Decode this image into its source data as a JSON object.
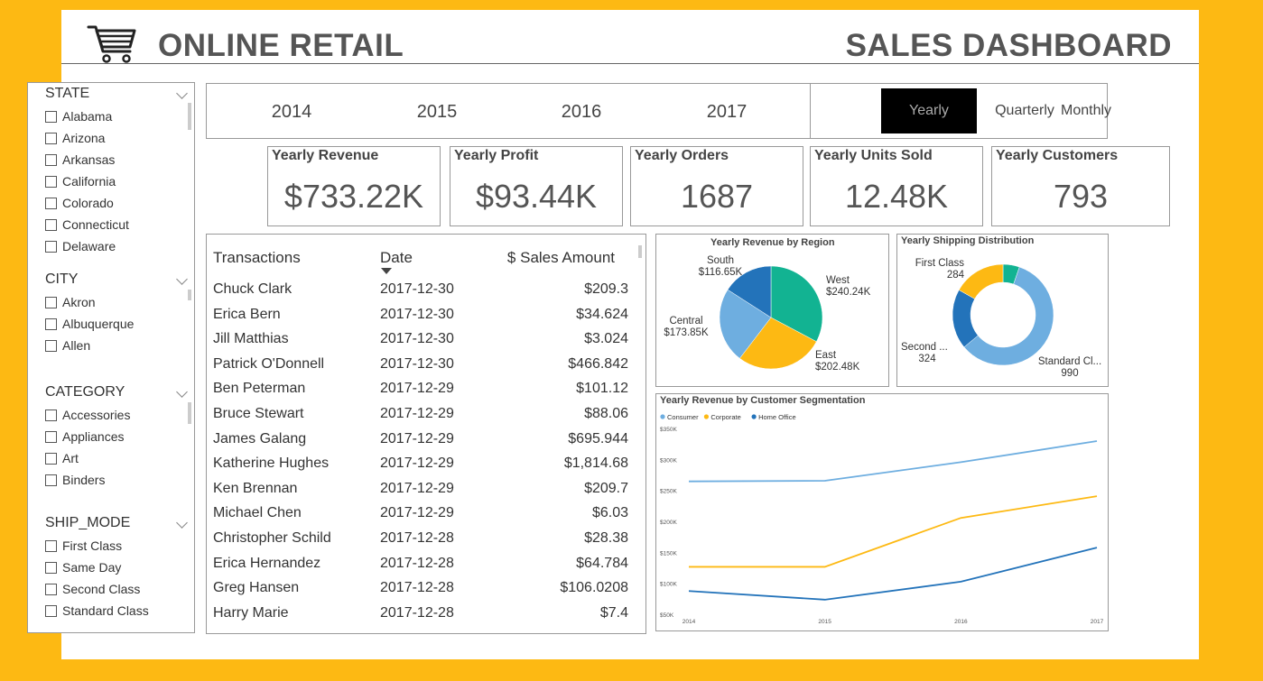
{
  "header": {
    "left_title": "ONLINE RETAIL",
    "right_title": "SALES DASHBOARD",
    "cart_icon": "shopping-cart-icon"
  },
  "filters": {
    "state": {
      "label": "STATE",
      "items": [
        "Alabama",
        "Arizona",
        "Arkansas",
        "California",
        "Colorado",
        "Connecticut",
        "Delaware"
      ]
    },
    "city": {
      "label": "CITY",
      "items": [
        "Akron",
        "Albuquerque",
        "Allen"
      ]
    },
    "category": {
      "label": "CATEGORY",
      "items": [
        "Accessories",
        "Appliances",
        "Art",
        "Binders"
      ]
    },
    "ship_mode": {
      "label": "SHIP_MODE",
      "items": [
        "First Class",
        "Same Day",
        "Second Class",
        "Standard Class"
      ]
    }
  },
  "years": [
    "2014",
    "2015",
    "2016",
    "2017"
  ],
  "periods": {
    "yearly": "Yearly",
    "quarterly": "Quarterly",
    "monthly": "Monthly",
    "active": "Yearly"
  },
  "kpis": [
    {
      "label": "Yearly Revenue",
      "value": "$733.22K"
    },
    {
      "label": "Yearly Profit",
      "value": "$93.44K"
    },
    {
      "label": "Yearly Orders",
      "value": "1687"
    },
    {
      "label": "Yearly Units Sold",
      "value": "12.48K"
    },
    {
      "label": "Yearly Customers",
      "value": "793"
    }
  ],
  "transactions": {
    "headers": {
      "name": "Transactions",
      "date": "Date",
      "amount": "$ Sales Amount"
    },
    "rows": [
      [
        "Chuck Clark",
        "2017-12-30",
        "$209.3"
      ],
      [
        "Erica Bern",
        "2017-12-30",
        "$34.624"
      ],
      [
        "Jill Matthias",
        "2017-12-30",
        "$3.024"
      ],
      [
        "Patrick O'Donnell",
        "2017-12-30",
        "$466.842"
      ],
      [
        "Ben Peterman",
        "2017-12-29",
        "$101.12"
      ],
      [
        "Bruce Stewart",
        "2017-12-29",
        "$88.06"
      ],
      [
        "James Galang",
        "2017-12-29",
        "$695.944"
      ],
      [
        "Katherine Hughes",
        "2017-12-29",
        "$1,814.68"
      ],
      [
        "Ken Brennan",
        "2017-12-29",
        "$209.7"
      ],
      [
        "Michael Chen",
        "2017-12-29",
        "$6.03"
      ],
      [
        "Christopher Schild",
        "2017-12-28",
        "$28.38"
      ],
      [
        "Erica Hernandez",
        "2017-12-28",
        "$64.784"
      ],
      [
        "Greg Hansen",
        "2017-12-28",
        "$106.0208"
      ],
      [
        "Harry Marie",
        "2017-12-28",
        "$7.4"
      ]
    ]
  },
  "colors": {
    "light_blue": "#6EAEE0",
    "yellow": "#FDB913",
    "dark_blue": "#2373BA",
    "teal": "#12B392"
  },
  "chart_data": [
    {
      "type": "pie",
      "title": "Yearly Revenue by Region",
      "slices": [
        {
          "name": "West",
          "value": 240.24,
          "label": "$240.24K",
          "color": "#12B392"
        },
        {
          "name": "East",
          "value": 202.48,
          "label": "$202.48K",
          "color": "#FDB913"
        },
        {
          "name": "Central",
          "value": 173.85,
          "label": "$173.85K",
          "color": "#6EAEE0"
        },
        {
          "name": "South",
          "value": 116.65,
          "label": "$116.65K",
          "color": "#2373BA"
        }
      ]
    },
    {
      "type": "pie",
      "title": "Yearly Shipping Distribution",
      "slices": [
        {
          "name": "Standard Cl...",
          "value": 990,
          "label": "990",
          "color": "#6EAEE0"
        },
        {
          "name": "Second ...",
          "value": 324,
          "label": "324",
          "color": "#2373BA"
        },
        {
          "name": "First Class",
          "value": 284,
          "label": "284",
          "color": "#FDB913"
        },
        {
          "name": "Same Day",
          "value": 89,
          "label": "",
          "color": "#12B392"
        }
      ]
    },
    {
      "type": "line",
      "title": "Yearly Revenue by Customer Segmentation",
      "x": [
        "2014",
        "2015",
        "2016",
        "2017"
      ],
      "ylim": [
        50,
        350
      ],
      "yticks": [
        "$50K",
        "$100K",
        "$150K",
        "$200K",
        "$250K",
        "$300K",
        "$350K"
      ],
      "series": [
        {
          "name": "Consumer",
          "color": "#6EAEE0",
          "values": [
            266,
            267,
            297,
            331
          ]
        },
        {
          "name": "Corporate",
          "color": "#FDB913",
          "values": [
            128,
            128,
            207,
            242
          ]
        },
        {
          "name": "Home Office",
          "color": "#2373BA",
          "values": [
            89,
            75,
            104,
            159
          ]
        }
      ]
    }
  ]
}
